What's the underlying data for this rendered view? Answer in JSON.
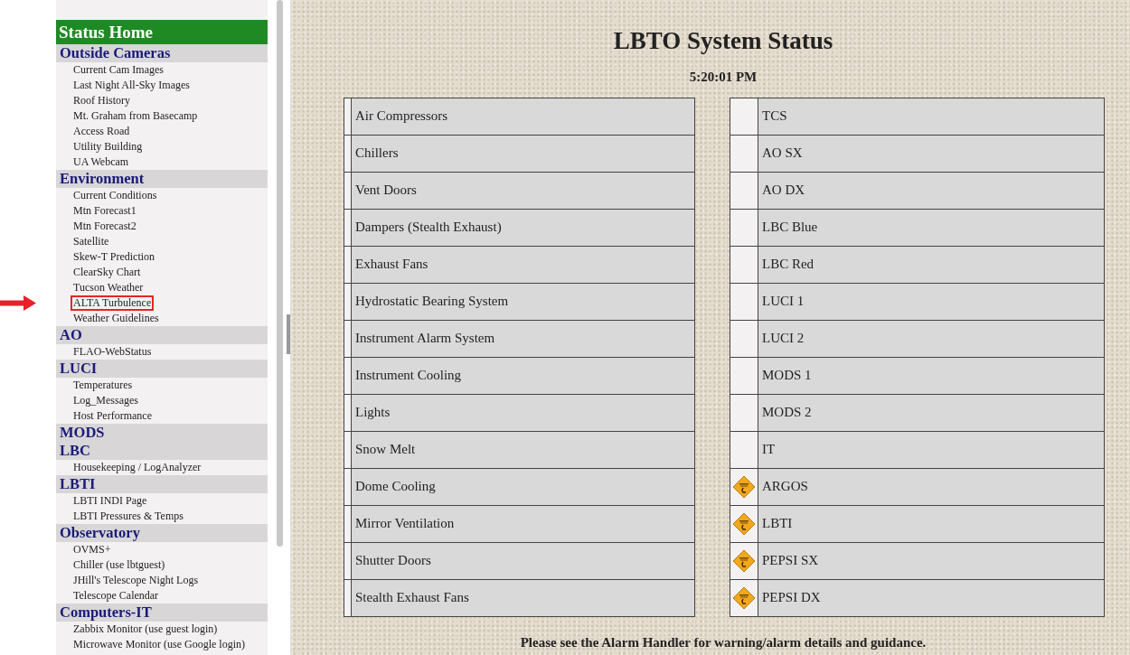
{
  "sidebar": {
    "title": "Status Home",
    "sections": [
      {
        "heading": "Outside Cameras",
        "items": [
          {
            "label": "Current Cam Images",
            "highlighted": false
          },
          {
            "label": "Last Night All-Sky Images",
            "highlighted": false
          },
          {
            "label": "Roof History",
            "highlighted": false
          },
          {
            "label": "Mt. Graham from Basecamp",
            "highlighted": false
          },
          {
            "label": "Access Road",
            "highlighted": false
          },
          {
            "label": "Utility Building",
            "highlighted": false
          },
          {
            "label": "UA Webcam",
            "highlighted": false
          }
        ]
      },
      {
        "heading": "Environment",
        "items": [
          {
            "label": "Current Conditions",
            "highlighted": false
          },
          {
            "label": "Mtn Forecast1",
            "highlighted": false
          },
          {
            "label": "Mtn Forecast2",
            "highlighted": false
          },
          {
            "label": "Satellite",
            "highlighted": false
          },
          {
            "label": "Skew-T Prediction",
            "highlighted": false
          },
          {
            "label": "ClearSky Chart",
            "highlighted": false
          },
          {
            "label": "Tucson Weather",
            "highlighted": false
          },
          {
            "label": "ALTA Turbulence",
            "highlighted": true
          },
          {
            "label": "Weather Guidelines",
            "highlighted": false
          }
        ]
      },
      {
        "heading": "AO",
        "items": [
          {
            "label": "FLAO-WebStatus",
            "highlighted": false
          }
        ]
      },
      {
        "heading": "LUCI",
        "items": [
          {
            "label": "Temperatures",
            "highlighted": false
          },
          {
            "label": "Log_Messages",
            "highlighted": false
          },
          {
            "label": "Host Performance",
            "highlighted": false
          }
        ]
      },
      {
        "heading": "MODS"
      },
      {
        "heading": "LBC",
        "items": [
          {
            "label": "Housekeeping / LogAnalyzer",
            "highlighted": false
          }
        ]
      },
      {
        "heading": "LBTI",
        "items": [
          {
            "label": "LBTI INDI Page",
            "highlighted": false
          },
          {
            "label": "LBTI Pressures & Temps",
            "highlighted": false
          }
        ]
      },
      {
        "heading": "Observatory",
        "items": [
          {
            "label": "OVMS+",
            "highlighted": false
          },
          {
            "label": "Chiller (use lbtguest)",
            "highlighted": false
          },
          {
            "label": "JHill's Telescope Night Logs",
            "highlighted": false
          },
          {
            "label": "Telescope Calendar",
            "highlighted": false
          }
        ]
      },
      {
        "heading": "Computers-IT",
        "items": [
          {
            "label": "Zabbix Monitor (use guest login)",
            "highlighted": false
          },
          {
            "label": "Microwave Monitor (use Google login)",
            "highlighted": false
          }
        ]
      }
    ]
  },
  "title": "LBTO System Status",
  "time": "5:20:01 PM",
  "facilities": [
    {
      "name": "Air Compressors"
    },
    {
      "name": "Chillers"
    },
    {
      "name": "Vent Doors"
    },
    {
      "name": "Dampers (Stealth Exhaust)"
    },
    {
      "name": "Exhaust Fans"
    },
    {
      "name": "Hydrostatic Bearing System"
    },
    {
      "name": "Instrument Alarm System"
    },
    {
      "name": "Instrument Cooling"
    },
    {
      "name": "Lights"
    },
    {
      "name": "Snow Melt"
    },
    {
      "name": "Dome Cooling"
    },
    {
      "name": "Mirror Ventilation"
    },
    {
      "name": "Shutter Doors"
    },
    {
      "name": "Stealth Exhaust Fans"
    }
  ],
  "instruments": [
    {
      "name": "TCS",
      "warning": false
    },
    {
      "name": "AO SX",
      "warning": false
    },
    {
      "name": "AO DX",
      "warning": false
    },
    {
      "name": "LBC Blue",
      "warning": false
    },
    {
      "name": "LBC Red",
      "warning": false
    },
    {
      "name": "LUCI 1",
      "warning": false
    },
    {
      "name": "LUCI 2",
      "warning": false
    },
    {
      "name": "MODS 1",
      "warning": false
    },
    {
      "name": "MODS 2",
      "warning": false
    },
    {
      "name": "IT",
      "warning": false
    },
    {
      "name": "ARGOS",
      "warning": true
    },
    {
      "name": "LBTI",
      "warning": true
    },
    {
      "name": "PEPSI SX",
      "warning": true
    },
    {
      "name": "PEPSI DX",
      "warning": true
    }
  ],
  "footer": "Please see the Alarm Handler for warning/alarm details and guidance."
}
